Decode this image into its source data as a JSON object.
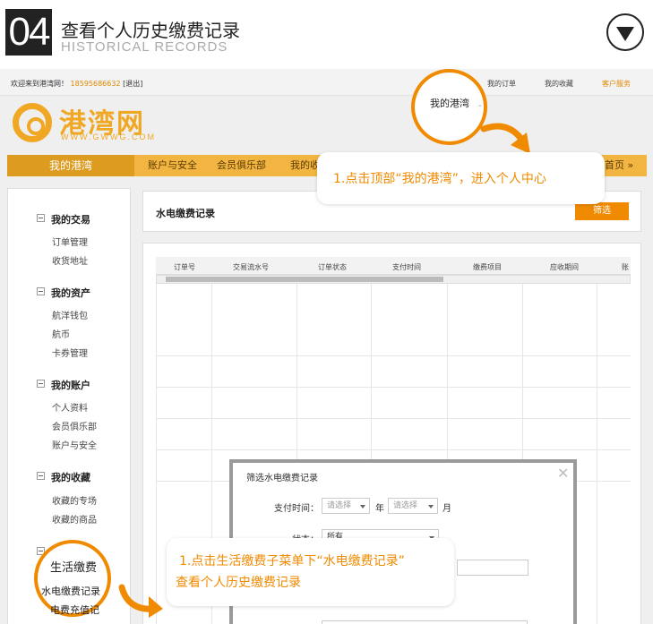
{
  "header": {
    "step_number": "04",
    "title": "查看个人历史缴费记录",
    "subtitle": "HISTORICAL RECORDS"
  },
  "site": {
    "welcome": "欢迎来到港湾网！",
    "phone": "18595686632",
    "logout": "[退出]",
    "top_nav": [
      "我的订单",
      "我的收藏",
      "客户服务"
    ],
    "logo_text": "港湾网",
    "logo_url": "WWW.GWWG.COM",
    "main_tab": "我的港湾",
    "nav_items": [
      "账户与安全",
      "会员俱乐部",
      "我的收"
    ],
    "home": "首页 »"
  },
  "sidebar": {
    "sections": [
      {
        "title": "我的交易",
        "items": [
          "订单管理",
          "收货地址"
        ]
      },
      {
        "title": "我的资产",
        "items": [
          "航洋钱包",
          "航币",
          "卡券管理"
        ]
      },
      {
        "title": "我的账户",
        "items": [
          "个人资料",
          "会员俱乐部",
          "账户与安全"
        ]
      },
      {
        "title": "我的收藏",
        "items": [
          "收藏的专场",
          "收藏的商品"
        ]
      }
    ]
  },
  "panel": {
    "title": "水电缴费记录",
    "filter_button": "筛选",
    "columns": [
      "订单号",
      "交易流水号",
      "订单状态",
      "支付时间",
      "缴费项目",
      "应收期间",
      "账"
    ]
  },
  "modal": {
    "title": "筛选水电缴费记录",
    "close": "✕",
    "pay_time_label": "支付时间：",
    "select_placeholder": "请选择",
    "year_label": "年",
    "month_label": "月",
    "status_label": "状态：",
    "status_value": "所有"
  },
  "callouts": {
    "top_circle": "我的港湾",
    "top_text": "1.点击顶部“我的港湾”，进入个人中心",
    "bottom_circle": [
      "生活缴费",
      "水电缴费记录",
      "电费充值记"
    ],
    "bottom_text_1": "1.点击生活缴费子菜单下“水电缴费记录”",
    "bottom_text_2": "查看个人历史缴费记录"
  }
}
